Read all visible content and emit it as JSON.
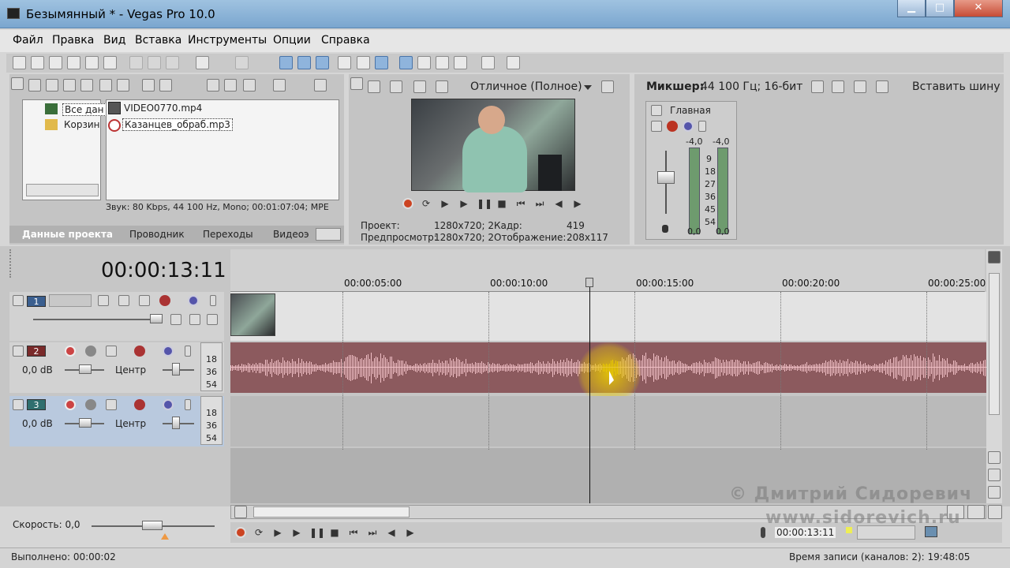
{
  "window": {
    "title": "Безымянный * - Vegas Pro 10.0",
    "minimize": "▁",
    "maximize": "□",
    "close": "✕"
  },
  "menu": [
    "Файл",
    "Правка",
    "Вид",
    "Вставка",
    "Инструменты",
    "Опции",
    "Справка"
  ],
  "explorer": {
    "tree_all": "Все дан",
    "tree_bin": "Корзин",
    "files": [
      "VIDEO0770.mp4",
      "Казанцев_обраб.mp3"
    ],
    "info": "Звук: 80 Kbps, 44 100 Hz, Mono; 00:01:07:04; MPE",
    "tabs": [
      "Данные проекта",
      "Проводник",
      "Переходы",
      "Видеоэ"
    ]
  },
  "preview": {
    "quality": "Отличное (Полное)",
    "project_label": "Проект:",
    "project_value": "1280x720; 2",
    "frame_label": "Кадр:",
    "frame_value": "419",
    "preview_label": "Предпросмотр:",
    "preview_value": "1280x720; 2",
    "display_label": "Отображение:",
    "display_value": "208x117"
  },
  "mixer": {
    "title": "Микшер:",
    "format": "44 100 Гц; 16-бит",
    "insert_bus": "Вставить шину",
    "main": "Главная",
    "peak_left": "-4,0",
    "peak_right": "-4,0",
    "scale": [
      "9",
      "18",
      "27",
      "36",
      "45",
      "54"
    ],
    "out_left": "0,0",
    "out_right": "0,0"
  },
  "timeline": {
    "timecode": "00:00:13:11",
    "ruler": [
      "00:00:05:00",
      "00:00:10:00",
      "00:00:15:00",
      "00:00:20:00",
      "00:00:25:00"
    ],
    "tracks": [
      {
        "number": "1",
        "color": "#3b5f8f"
      },
      {
        "number": "2",
        "color": "#7a2a2a",
        "vol": "0,0 dB",
        "pan": "Центр",
        "meter": [
          "18",
          "36",
          "54"
        ]
      },
      {
        "number": "3",
        "color": "#2f6f6f",
        "vol": "0,0 dB",
        "pan": "Центр",
        "meter": [
          "18",
          "36",
          "54"
        ]
      }
    ]
  },
  "status": {
    "speed": "Скорость: 0,0",
    "completed": "Выполнено: 00:00:02",
    "cursor_time": "00:00:13:11",
    "record_time": "Время записи (каналов: 2): 19:48:05"
  },
  "watermark": {
    "line1": "© Дмитрий Сидоревич",
    "line2": "www.sidorevich.ru"
  },
  "colors": {
    "audio_track": "#8c5a5e",
    "waveform": "#f0bfc5",
    "highlight": "#e8c800"
  }
}
